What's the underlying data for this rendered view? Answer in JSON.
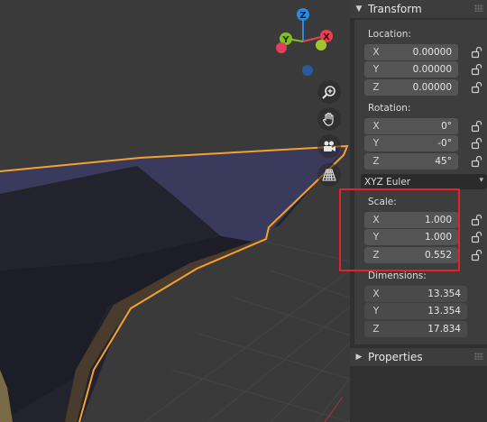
{
  "gizmo": {
    "x": "X",
    "y": "Y",
    "z": "Z"
  },
  "icons": {
    "zoom": "zoom-icon",
    "pan": "hand-pan-icon",
    "camera": "camera-icon",
    "ortho": "grid-perspective-icon",
    "lock": "padlock-icon"
  },
  "transform": {
    "header": "Transform",
    "location": {
      "label": "Location:",
      "x": {
        "axis": "X",
        "value": "0.00000"
      },
      "y": {
        "axis": "Y",
        "value": "0.00000"
      },
      "z": {
        "axis": "Z",
        "value": "0.00000"
      }
    },
    "rotation": {
      "label": "Rotation:",
      "x": {
        "axis": "X",
        "value": "0°"
      },
      "y": {
        "axis": "Y",
        "value": "-0°"
      },
      "z": {
        "axis": "Z",
        "value": "45°"
      },
      "mode": "XYZ Euler"
    },
    "scale": {
      "label": "Scale:",
      "x": {
        "axis": "X",
        "value": "1.000"
      },
      "y": {
        "axis": "Y",
        "value": "1.000"
      },
      "z": {
        "axis": "Z",
        "value": "0.552"
      }
    },
    "dimensions": {
      "label": "Dimensions:",
      "x": {
        "axis": "X",
        "value": "13.354"
      },
      "y": {
        "axis": "Y",
        "value": "13.354"
      },
      "z": {
        "axis": "Z",
        "value": "17.834"
      }
    }
  },
  "properties": {
    "header": "Properties"
  },
  "colors": {
    "selection_outline": "#f5a030",
    "highlight_box": "#e8202a",
    "axis_x": "#e84050",
    "axis_y": "#80c020",
    "axis_z": "#2a8ae0"
  }
}
